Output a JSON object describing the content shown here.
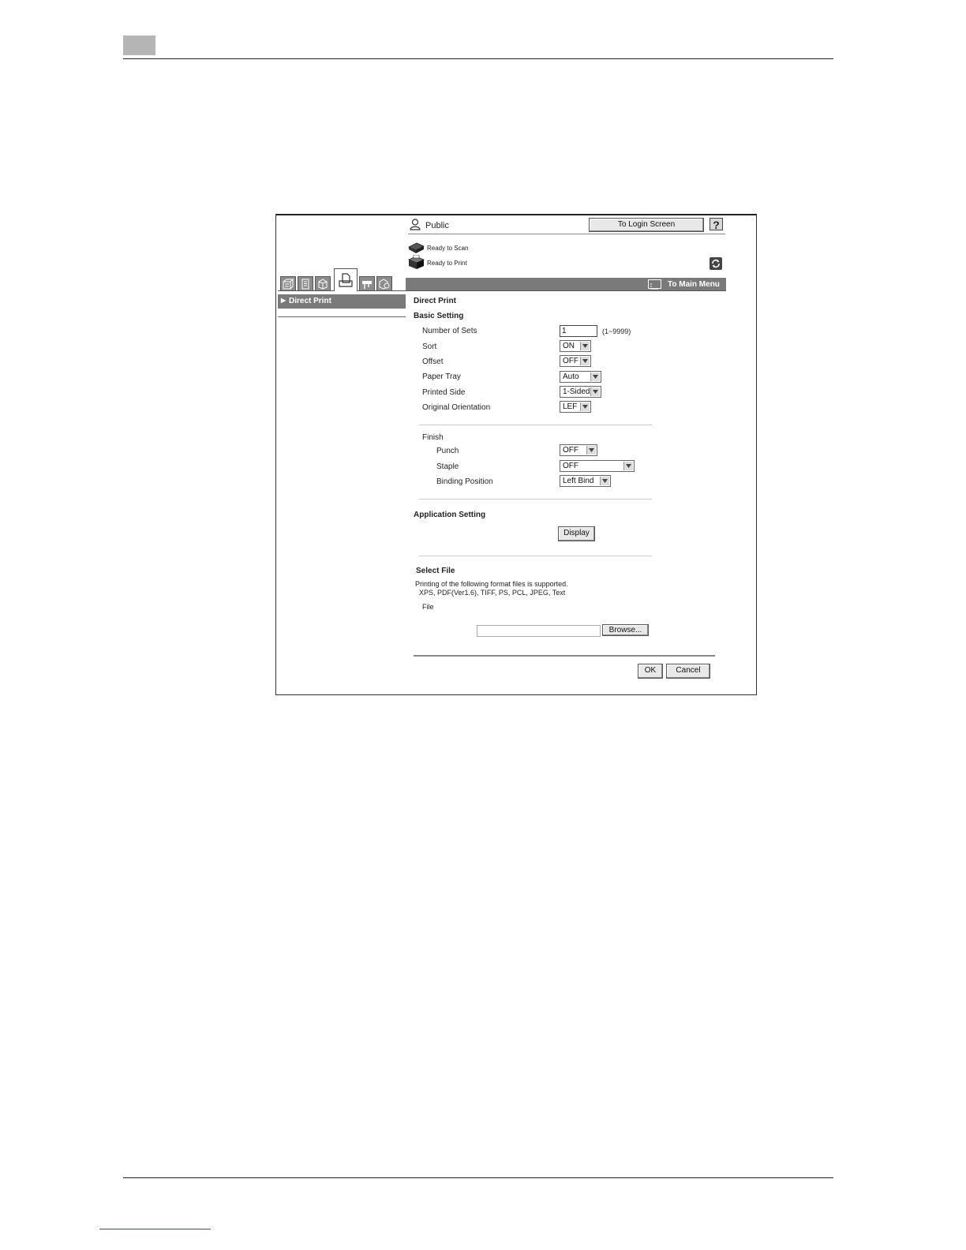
{
  "header": {
    "user_label": "Public",
    "login_button": "To Login Screen",
    "help_button": "?"
  },
  "status": {
    "scan": "Ready to Scan",
    "print": "Ready to Print"
  },
  "nav": {
    "main_menu": "To Main Menu"
  },
  "sidebar": {
    "items": [
      {
        "label": "Direct Print"
      }
    ]
  },
  "main": {
    "title": "Direct Print",
    "basic_setting": {
      "heading": "Basic Setting",
      "number_of_sets": {
        "label": "Number of Sets",
        "value": "1",
        "range": "(1~9999)"
      },
      "sort": {
        "label": "Sort",
        "value": "ON"
      },
      "offset": {
        "label": "Offset",
        "value": "OFF"
      },
      "paper_tray": {
        "label": "Paper Tray",
        "value": "Auto"
      },
      "printed_side": {
        "label": "Printed Side",
        "value": "1-Sided"
      },
      "original_orientation": {
        "label": "Original Orientation",
        "value": "LEF"
      }
    },
    "finish": {
      "heading": "Finish",
      "punch": {
        "label": "Punch",
        "value": "OFF"
      },
      "staple": {
        "label": "Staple",
        "value": "OFF"
      },
      "binding_position": {
        "label": "Binding Position",
        "value": "Left Bind"
      }
    },
    "application_setting": {
      "heading": "Application Setting",
      "display_button": "Display"
    },
    "select_file": {
      "heading": "Select File",
      "supported_note": "Printing of the following format files is supported.",
      "formats": "XPS, PDF(Ver1.6), TIFF, PS, PCL, JPEG, Text",
      "file_label": "File",
      "file_value": "",
      "browse_button": "Browse..."
    },
    "ok_button": "OK",
    "cancel_button": "Cancel"
  },
  "colors": {
    "menu_strip": "#7a7a7a",
    "tab_inactive": "#8c8c8c",
    "page_tab": "#b5b5b5"
  }
}
